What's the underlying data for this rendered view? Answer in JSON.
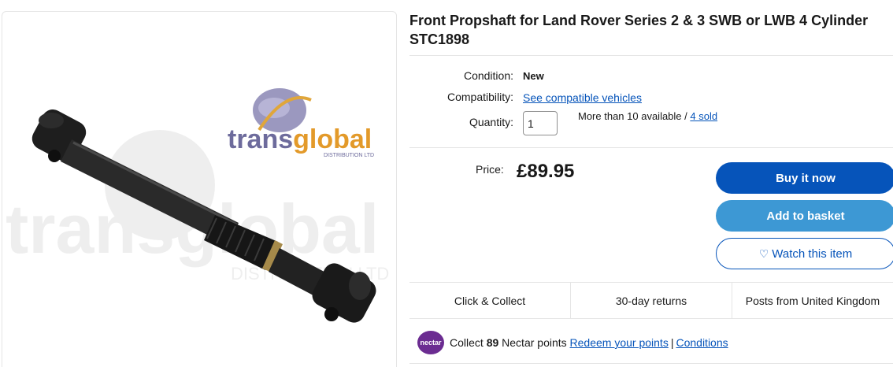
{
  "product": {
    "image_alt": "Front Propshaft product photo",
    "watermark_brand": "transglobal",
    "watermark_sub": "DISTRIBUTION LTD",
    "title": "Front Propshaft for Land Rover Series 2 & 3 SWB or LWB 4 Cylinder STC1898"
  },
  "specs": {
    "condition_label": "Condition:",
    "condition_value": "New",
    "compatibility_label": "Compatibility:",
    "compatibility_link": "See compatible vehicles",
    "quantity_label": "Quantity:",
    "quantity_value": "1",
    "availability_text": "More than 10 available / ",
    "sold_link": "4 sold"
  },
  "price": {
    "label": "Price:",
    "value": "£89.95"
  },
  "actions": {
    "buy_now": "Buy it now",
    "add_to_basket": "Add to basket",
    "watch": "Watch this item",
    "watch_icon": "heart-outline-icon"
  },
  "features": [
    "Click & Collect",
    "30-day returns",
    "Posts from United Kingdom"
  ],
  "nectar": {
    "logo_text": "nectar",
    "collect_prefix": "Collect ",
    "points": "89",
    "collect_suffix": " Nectar points ",
    "redeem_link": "Redeem your points",
    "separator": "|",
    "conditions_link": "Conditions"
  },
  "colors": {
    "primary_blue": "#0654ba",
    "secondary_blue": "#3d98d4",
    "nectar_purple": "#6b2c91",
    "text": "#191919",
    "border": "#e5e5e5"
  }
}
